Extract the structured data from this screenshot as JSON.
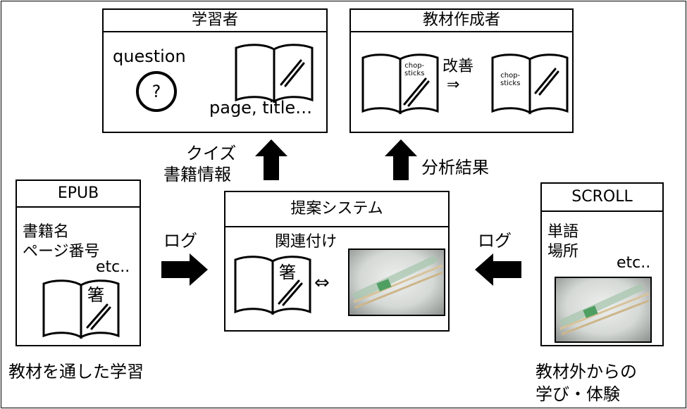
{
  "learner": {
    "title": "学習者",
    "question": "question",
    "question_mark": "?",
    "book_caption": "page, title…"
  },
  "creator": {
    "title": "教材作成者",
    "improve": "改善",
    "arrow": "⇒",
    "book_text_before": "chop-\nsticks",
    "book_text_after": "chop-\nsticks"
  },
  "epub": {
    "title": "EPUB",
    "line1": "書籍名",
    "line2": "ページ番号",
    "line3": "etc..",
    "book_char": "箸",
    "caption": "教材を通した学習"
  },
  "system": {
    "title": "提案システム",
    "subtitle": "関連付け",
    "book_char": "箸",
    "link_arrow": "⇔"
  },
  "scroll": {
    "title": "SCROLL",
    "line1": "単語",
    "line2": "場所",
    "line3": "etc..",
    "caption_line1": "教材外からの",
    "caption_line2": "学び・体験"
  },
  "arrows": {
    "quiz_line1": "クイズ",
    "quiz_line2": "書籍情報",
    "analysis": "分析結果",
    "log_left": "ログ",
    "log_right": "ログ"
  }
}
